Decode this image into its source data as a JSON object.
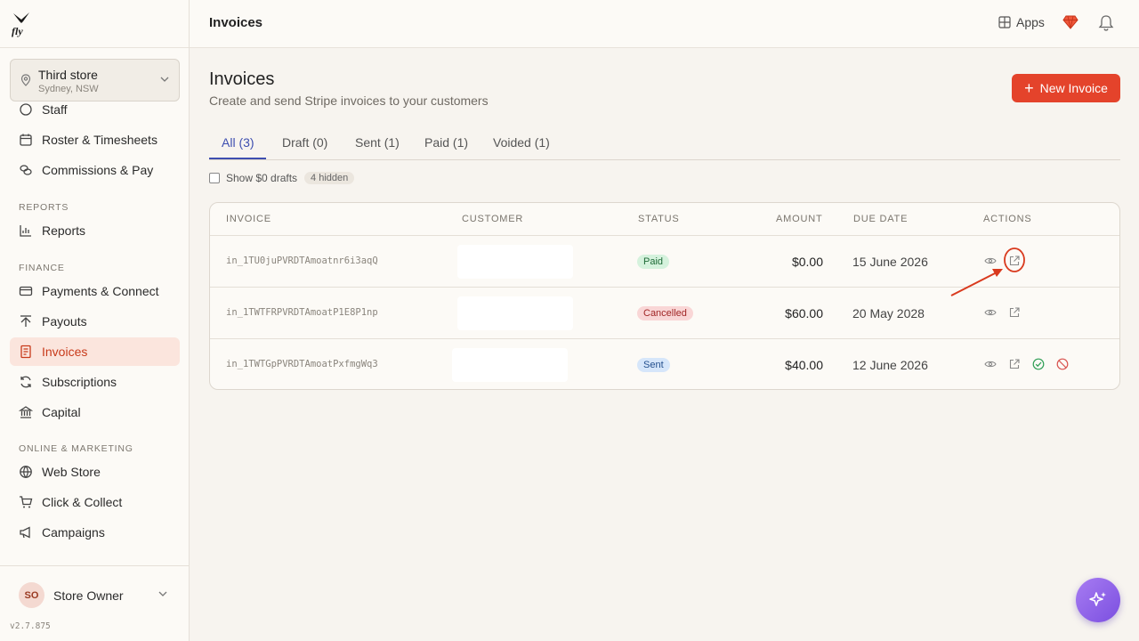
{
  "app": {
    "logo_text": "fly",
    "version": "v2.7.875"
  },
  "store": {
    "name": "Third store",
    "location": "Sydney, NSW"
  },
  "sidebar": {
    "items_top": [
      {
        "label": "Staff",
        "icon": "staff-icon"
      },
      {
        "label": "Roster & Timesheets",
        "icon": "calendar-icon"
      },
      {
        "label": "Commissions & Pay",
        "icon": "coins-icon"
      }
    ],
    "section_reports": "REPORTS",
    "reports": [
      {
        "label": "Reports",
        "icon": "bar-chart-icon"
      }
    ],
    "section_finance": "FINANCE",
    "finance": [
      {
        "label": "Payments & Connect",
        "icon": "card-icon"
      },
      {
        "label": "Payouts",
        "icon": "payout-icon"
      },
      {
        "label": "Invoices",
        "icon": "invoice-icon",
        "active": true
      },
      {
        "label": "Subscriptions",
        "icon": "refresh-icon"
      },
      {
        "label": "Capital",
        "icon": "bank-icon"
      }
    ],
    "section_online": "ONLINE & MARKETING",
    "online": [
      {
        "label": "Web Store",
        "icon": "globe-icon"
      },
      {
        "label": "Click & Collect",
        "icon": "cart-icon"
      },
      {
        "label": "Campaigns",
        "icon": "megaphone-icon"
      }
    ]
  },
  "user": {
    "initials": "SO",
    "name": "Store Owner"
  },
  "topbar": {
    "title": "Invoices",
    "apps_label": "Apps"
  },
  "page": {
    "title": "Invoices",
    "subtitle": "Create and send Stripe invoices to your customers",
    "new_button": "New Invoice",
    "tabs": [
      {
        "label": "All (3)",
        "active": true
      },
      {
        "label": "Draft (0)"
      },
      {
        "label": "Sent (1)"
      },
      {
        "label": "Paid (1)"
      },
      {
        "label": "Voided (1)"
      }
    ],
    "show_drafts_label": "Show $0 drafts",
    "hidden_badge": "4 hidden"
  },
  "table": {
    "headers": [
      "INVOICE",
      "CUSTOMER",
      "STATUS",
      "AMOUNT",
      "DUE DATE",
      "ACTIONS"
    ],
    "rows": [
      {
        "invoice": "in_1TU0juPVRDTAmoatnr6i3aqQ",
        "customer": "",
        "status": "Paid",
        "amount": "$0.00",
        "due": "15 June 2026"
      },
      {
        "invoice": "in_1TWTFRPVRDTAmoatP1E8P1np",
        "customer": "",
        "status": "Cancelled",
        "amount": "$60.00",
        "due": "20 May 2028"
      },
      {
        "invoice": "in_1TWTGpPVRDTAmoatPxfmgWq3",
        "customer": "",
        "status": "Sent",
        "amount": "$40.00",
        "due": "12 June 2026"
      }
    ]
  },
  "colors": {
    "accent": "#e4432b",
    "tab_active": "#3e4fb0",
    "annotation": "#d93a1e",
    "fab": "#8b5cf6"
  }
}
